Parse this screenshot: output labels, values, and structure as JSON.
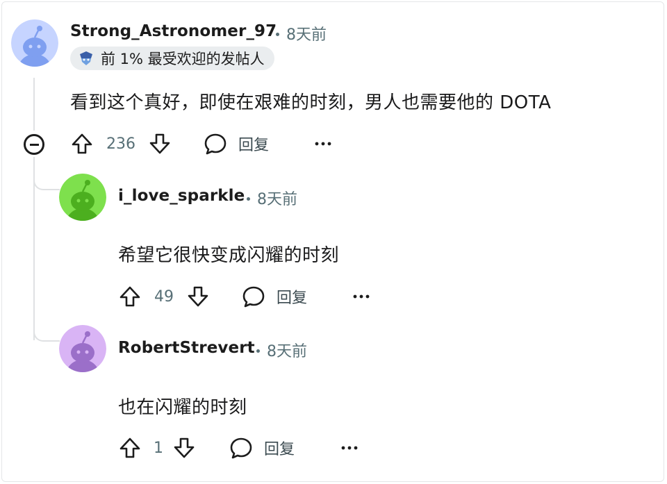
{
  "comments": [
    {
      "username": "Strong_Astronomer_97",
      "time": "8天前",
      "flair": "前 1% 最受欢迎的发帖人",
      "body": "看到这个真好，即使在艰难的时刻，男人也需要他的 DOTA",
      "votes": "236",
      "reply_label": "回复",
      "avatar_color": "#7f9ff0",
      "avatar_bg": "#c6d4ff"
    },
    {
      "username": "i_love_sparkle",
      "time": "8天前",
      "body": "希望它很快变成闪耀的时刻",
      "votes": "49",
      "reply_label": "回复",
      "avatar_color": "#4caf1f",
      "avatar_bg": "#7ee04d"
    },
    {
      "username": "RobertStrevert",
      "time": "8天前",
      "body": "也在闪耀的时刻",
      "votes": "1",
      "reply_label": "回复",
      "avatar_color": "#9b6fc9",
      "avatar_bg": "#d9b4f5"
    }
  ],
  "icons": {
    "upvote": "arrow-up-icon",
    "downvote": "arrow-down-icon",
    "reply": "speech-bubble-icon",
    "more": "more-icon",
    "collapse": "collapse-icon",
    "flair": "crown-icon"
  }
}
